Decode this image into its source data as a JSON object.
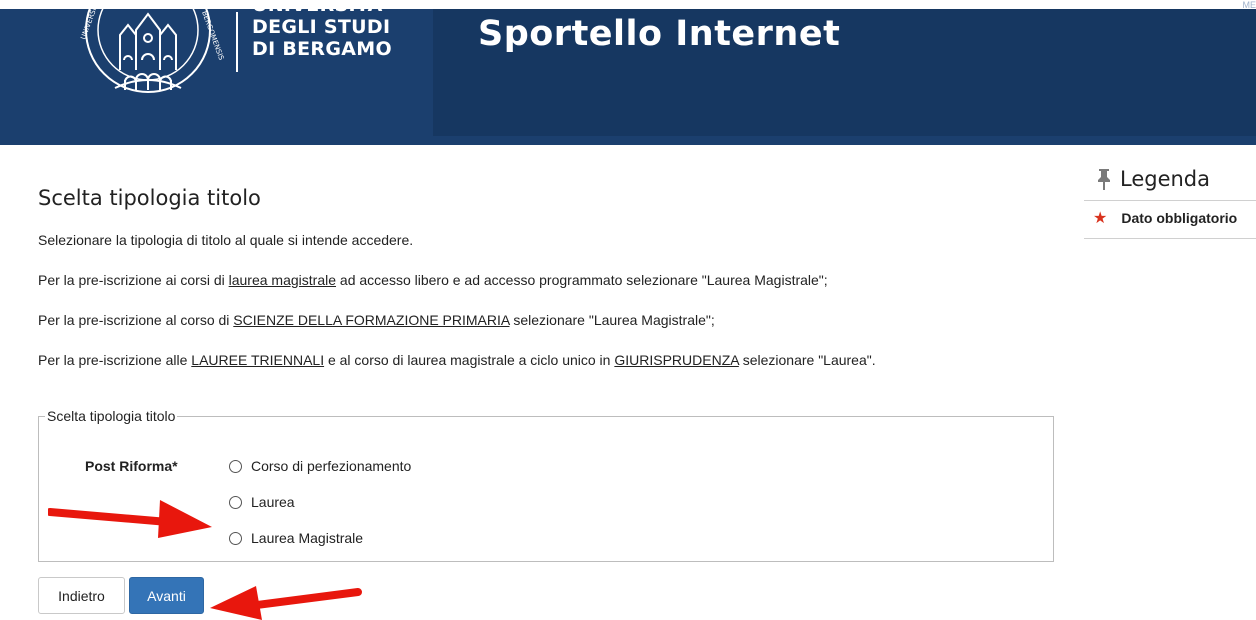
{
  "header": {
    "university_lines": [
      "UNIVERSITÀ",
      "DEGLI STUDI",
      "DI BERGAMO"
    ],
    "site_title": "Sportello Internet",
    "corner_text": "ME",
    "logo_icon": "university-crest-icon",
    "brand_color": "#1b3f6e"
  },
  "main": {
    "title": "Scelta tipologia titolo",
    "intro": "Selezionare la tipologia di titolo al quale si intende accedere.",
    "line2": {
      "before": "Per la pre-iscrizione ai corsi di ",
      "link": "laurea magistrale",
      "after": " ad accesso libero e ad accesso programmato selezionare \"Laurea Magistrale\";"
    },
    "line3": {
      "before": "Per la pre-iscrizione al corso di ",
      "link": "SCIENZE DELLA FORMAZIONE PRIMARIA",
      "after": " selezionare \"Laurea Magistrale\";"
    },
    "line4": {
      "before": "Per la pre-iscrizione alle ",
      "link1": "LAUREE TRIENNALI",
      "middle": " e al corso di laurea magistrale a ciclo unico in ",
      "link2": "GIURISPRUDENZA",
      "after": " selezionare \"Laurea\"."
    }
  },
  "form": {
    "legend": "Scelta tipologia titolo",
    "field_label": "Post Riforma*",
    "options": [
      "Corso di perfezionamento",
      "Laurea",
      "Laurea Magistrale"
    ],
    "selected": null
  },
  "buttons": {
    "back": "Indietro",
    "next": "Avanti",
    "next_color": "#3474b7"
  },
  "legend": {
    "title": "Legenda",
    "icon": "pin-icon",
    "items": [
      {
        "icon": "asterisk-icon",
        "label": "Dato obbligatorio",
        "color": "#d9331e"
      }
    ]
  },
  "annotations": {
    "arrow_color": "#e8170d",
    "arrows": [
      "arrow-to-laurea-magistrale",
      "arrow-to-avanti"
    ]
  }
}
